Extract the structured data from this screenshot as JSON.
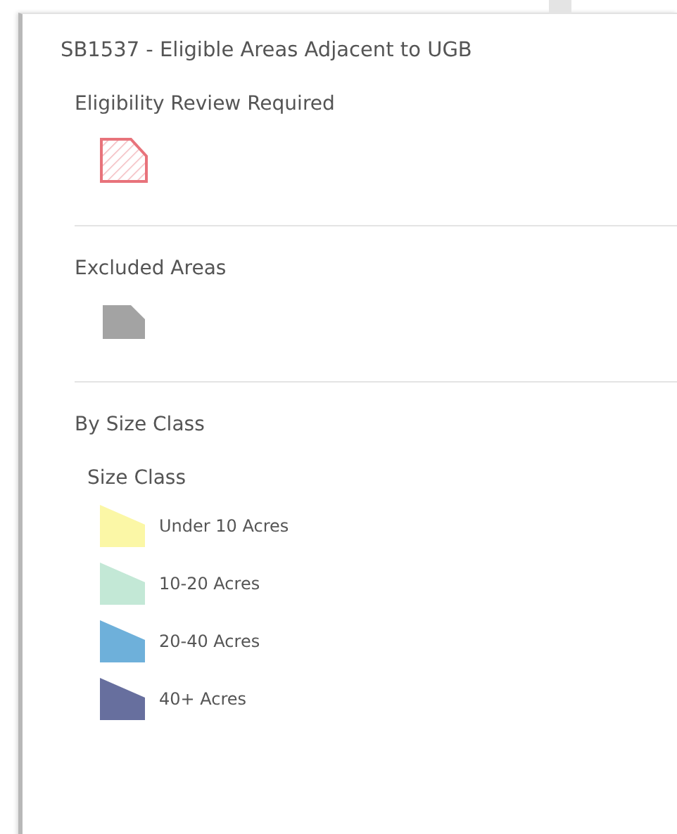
{
  "title": "SB1537 - Eligible Areas Adjacent to UGB",
  "sections": [
    {
      "label": "Eligibility Review Required",
      "kind": "symbol",
      "symbol": {
        "kind": "hatched",
        "color": "#e8737b"
      }
    },
    {
      "label": "Excluded Areas",
      "kind": "symbol",
      "symbol": {
        "kind": "solid",
        "color": "#a3a3a3"
      }
    },
    {
      "label": "By Size Class",
      "kind": "classes",
      "field": "Size Class",
      "items": [
        {
          "label": "Under 10 Acres",
          "color": "#fbf7a6"
        },
        {
          "label": "10-20 Acres",
          "color": "#c3e8d6"
        },
        {
          "label": "20-40 Acres",
          "color": "#6eb0da"
        },
        {
          "label": "40+ Acres",
          "color": "#676f9e"
        }
      ]
    }
  ]
}
